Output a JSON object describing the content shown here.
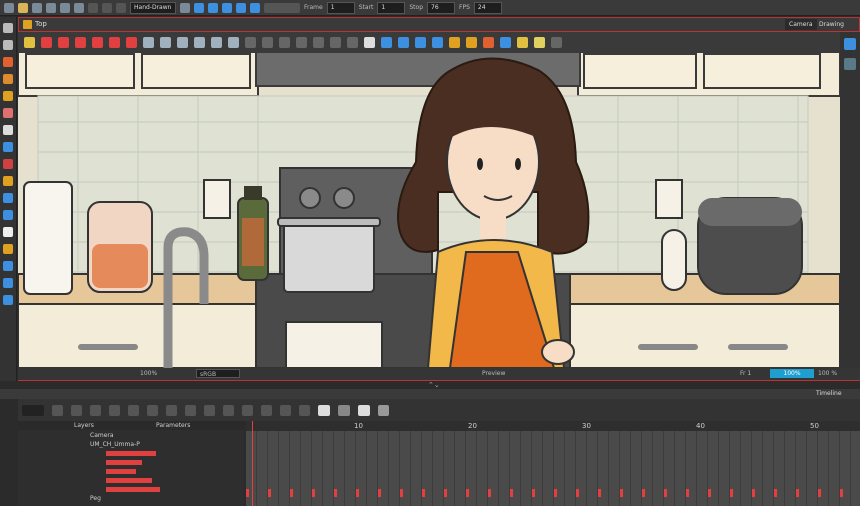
{
  "app": {
    "accent_color": "#3d8fe0",
    "frame_border_color": "#b33333"
  },
  "toolbar": {
    "render_mode": "Hand-Drawn",
    "frame_label": "Frame",
    "frame_value": "1",
    "start_label": "Start",
    "start_value": "1",
    "stop_label": "Stop",
    "stop_value": "76",
    "fps_label": "FPS",
    "fps_value": "24"
  },
  "camera_view": {
    "breadcrumb": "Top",
    "tabs": [
      {
        "label": "Camera",
        "active": true
      },
      {
        "label": "Drawing",
        "active": false
      }
    ],
    "status": {
      "zoom": "100%",
      "color_space": "sRGB",
      "preview": "Preview",
      "frame_indicator": "Fr 1",
      "zoom_right": "100%",
      "zoom_right2": "100 %"
    }
  },
  "timeline": {
    "panel_title": "Timeline",
    "layers_header": "Layers",
    "parameters_header": "Parameters",
    "layers": [
      {
        "name": "Camera",
        "color": "#cfcfcf"
      },
      {
        "name": "UM_CH_Umma-P",
        "color": "#cfcfcf"
      },
      {
        "name": "",
        "color": "#e04040"
      },
      {
        "name": "",
        "color": "#e04040"
      },
      {
        "name": "",
        "color": "#e04040"
      },
      {
        "name": "",
        "color": "#e04040"
      },
      {
        "name": "",
        "color": "#e04040"
      },
      {
        "name": "Peg",
        "color": "#cfcfcf"
      }
    ],
    "ruler": [
      "10",
      "20",
      "30",
      "40",
      "50"
    ]
  }
}
